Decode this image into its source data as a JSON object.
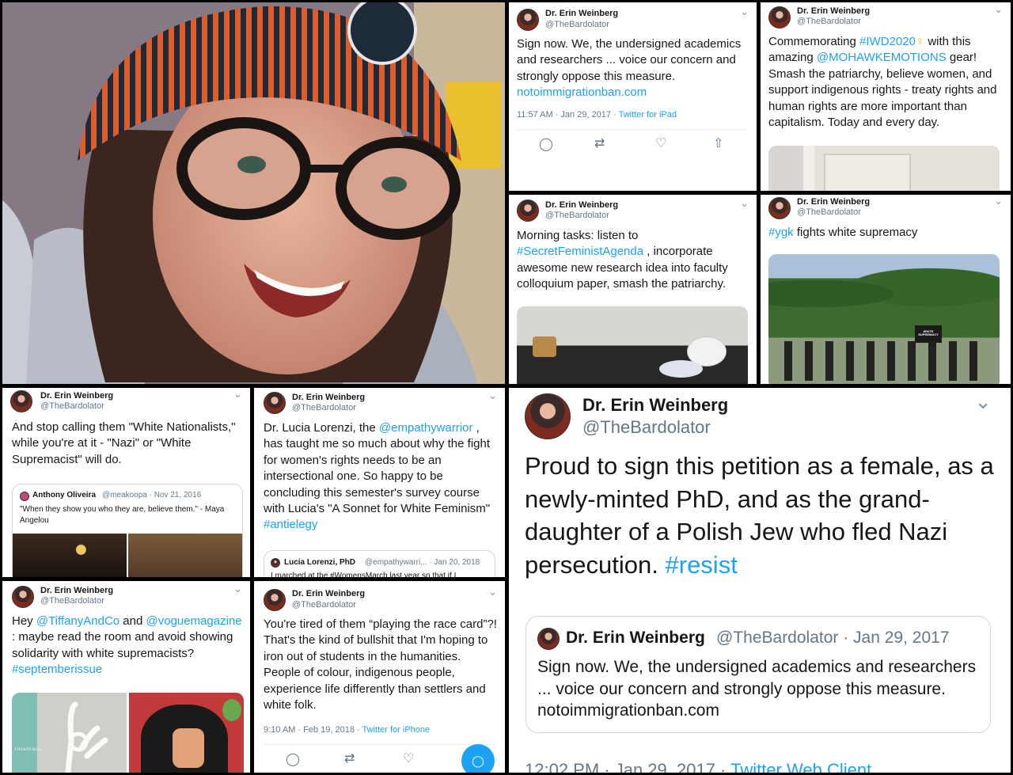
{
  "author": {
    "name": "Dr. Erin Weinberg",
    "handle": "@TheBardolator"
  },
  "tweets": {
    "t1": {
      "text_before": "Sign now.  We, the undersigned academics and researchers ... voice our concern and strongly oppose this measure.  ",
      "link": "notoimmigrationban.com",
      "timestamp": "11:57 AM · Jan 29, 2017 · ",
      "source": "Twitter for iPad"
    },
    "t2": {
      "p1": "Commemorating ",
      "tag": "#IWD2020",
      "symbol": "♀",
      "p2": " with this amazing ",
      "mention": "@MOHAWKEMOTIONS",
      "p3": " gear! Smash the patriarchy, believe women, and support indigenous rights - treaty rights and human rights are more important than capitalism. Today and every day."
    },
    "t3": {
      "p1": "Morning tasks: listen to ",
      "tag": "#SecretFeministAgenda",
      "p2": " , incorporate awesome new research idea into faculty colloquium paper, smash the patriarchy."
    },
    "t4": {
      "tag": "#ygk",
      "p1": " fights white supremacy",
      "sign": "WHITE SUPREMACY"
    },
    "t5": {
      "text": "And stop calling them \"White Nationalists,\" while you're at it - \"Nazi\" or \"White Supremacist\" will do.",
      "quote_name": "Anthony Oliveira",
      "quote_handle": "@meakoopa · Nov 21, 2016",
      "quote_text": "\"When they show you who they are, believe them.\" - Maya Angelou"
    },
    "t6": {
      "p1": "Dr. Lucia Lorenzi, the ",
      "mention": "@empathywarrior",
      "p2": " , has taught me so much about why the fight for women's rights needs to be an intersectional one. So happy to be concluding this semester's survey course with Lucia's \"A Sonnet for White Feminism\" ",
      "tag": "#antielegy",
      "quote_name": "Lucia Lorenzi, PhD",
      "quote_handle": "@empathywarri... · Jan 20, 2018",
      "quote_text": "I marched at the #WomensMarch last year so that if I"
    },
    "t7": {
      "p1": "Hey ",
      "m1": "@TiffanyAndCo",
      "p2": " and ",
      "m2": "@voguemagazine",
      "p3": " : maybe read the room and avoid showing solidarity with white supremacists? ",
      "tag": "#septemberissue",
      "brand": "TIFFANY&Co."
    },
    "t8": {
      "text": "You're tired of them “playing the race card”?! That's the kind of bullshit that I'm hoping to iron out of students in the humanities. People of colour, indigenous people, experience life differently than settlers and white folk.",
      "timestamp": "9:10 AM · Feb 19, 2018 · ",
      "source": "Twitter for iPhone"
    },
    "t9": {
      "text": "Proud to sign this petition as a female, as a newly-minted PhD, and as the grand-daughter of a Polish Jew who fled Nazi persecution. ",
      "tag": "#resist",
      "quote_meta": "@TheBardolator · Jan 29, 2017",
      "quote_text_before": "Sign now.  We, the undersigned academics and researchers ... voice our concern and strongly oppose this measure.  ",
      "quote_link": "notoimmigrationban.com",
      "timestamp": "12:02 PM · Jan 29, 2017 · ",
      "source": "Twitter Web Client"
    }
  },
  "icons": [
    "chevron-down-icon",
    "reply-icon",
    "retweet-icon",
    "like-icon",
    "share-icon",
    "venus-icon"
  ],
  "colors": {
    "link": "#1da1f2",
    "text": "#14171a",
    "muted": "#657786",
    "border": "#ccd6dd"
  }
}
